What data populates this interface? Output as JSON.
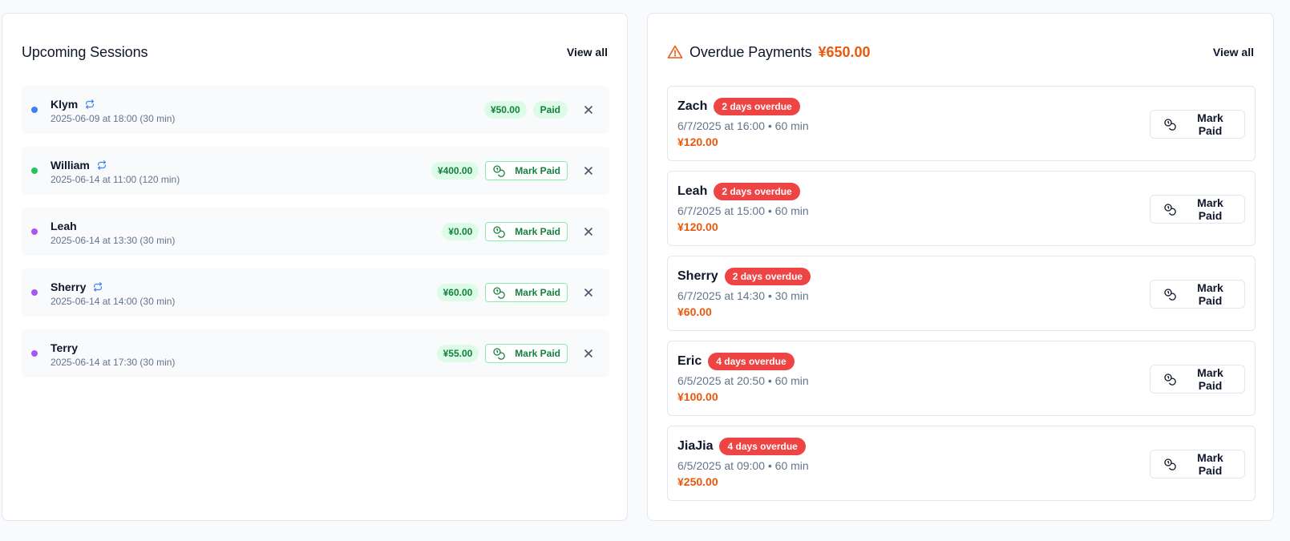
{
  "upcoming": {
    "title": "Upcoming Sessions",
    "view_all": "View all",
    "sessions": [
      {
        "name": "Klym",
        "recurring": true,
        "time": "2025-06-09 at 18:00 (30 min)",
        "price": "¥50.00",
        "status": "Paid",
        "dot_color": "#3b82f6"
      },
      {
        "name": "William",
        "recurring": true,
        "time": "2025-06-14 at 11:00 (120 min)",
        "price": "¥400.00",
        "action": "Mark Paid",
        "dot_color": "#22c55e"
      },
      {
        "name": "Leah",
        "recurring": false,
        "time": "2025-06-14 at 13:30 (30 min)",
        "price": "¥0.00",
        "action": "Mark Paid",
        "dot_color": "#a855f7"
      },
      {
        "name": "Sherry",
        "recurring": true,
        "time": "2025-06-14 at 14:00 (30 min)",
        "price": "¥60.00",
        "action": "Mark Paid",
        "dot_color": "#a855f7"
      },
      {
        "name": "Terry",
        "recurring": false,
        "time": "2025-06-14 at 17:30 (30 min)",
        "price": "¥55.00",
        "action": "Mark Paid",
        "dot_color": "#a855f7"
      }
    ]
  },
  "overdue": {
    "title": "Overdue Payments",
    "total": "¥650.00",
    "view_all": "View all",
    "items": [
      {
        "name": "Zach",
        "badge": "2 days overdue",
        "time": "6/7/2025 at 16:00 • 60 min",
        "amount": "¥120.00",
        "action": "Mark Paid"
      },
      {
        "name": "Leah",
        "badge": "2 days overdue",
        "time": "6/7/2025 at 15:00 • 60 min",
        "amount": "¥120.00",
        "action": "Mark Paid"
      },
      {
        "name": "Sherry",
        "badge": "2 days overdue",
        "time": "6/7/2025 at 14:30 • 30 min",
        "amount": "¥60.00",
        "action": "Mark Paid"
      },
      {
        "name": "Eric",
        "badge": "4 days overdue",
        "time": "6/5/2025 at 20:50 • 60 min",
        "amount": "¥100.00",
        "action": "Mark Paid"
      },
      {
        "name": "JiaJia",
        "badge": "4 days overdue",
        "time": "6/5/2025 at 09:00 • 60 min",
        "amount": "¥250.00",
        "action": "Mark Paid"
      }
    ]
  },
  "colors": {
    "accent_orange": "#ea580c",
    "overdue_red": "#ef4444",
    "paid_green": "#15803d",
    "recurring_blue": "#3b82f6"
  },
  "icons": {
    "warning": "warning-triangle-icon",
    "recurring": "repeat-icon",
    "mark_paid": "coins-icon",
    "remove": "close-icon"
  }
}
